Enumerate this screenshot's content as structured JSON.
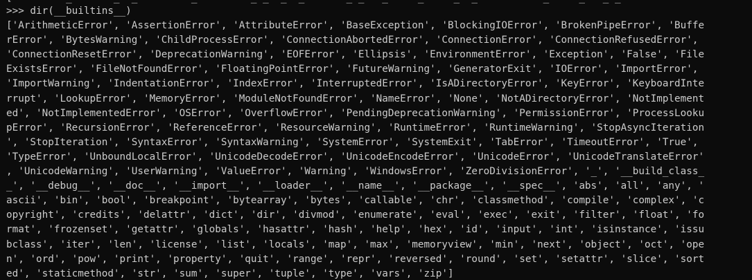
{
  "console": {
    "residue_line": "[         _       _  _         _         _ _  _  _       _ _   _     _     _  _           _     _   _ _",
    "prompt_line": ">>> dir(__builtins__)",
    "output_lines": [
      "['ArithmeticError', 'AssertionError', 'AttributeError', 'BaseException', 'BlockingIOError', 'BrokenPipeError', 'Buffe",
      "rError', 'BytesWarning', 'ChildProcessError', 'ConnectionAbortedError', 'ConnectionError', 'ConnectionRefusedError',",
      "'ConnectionResetError', 'DeprecationWarning', 'EOFError', 'Ellipsis', 'EnvironmentError', 'Exception', 'False', 'File",
      "ExistsError', 'FileNotFoundError', 'FloatingPointError', 'FutureWarning', 'GeneratorExit', 'IOError', 'ImportError',",
      "'ImportWarning', 'IndentationError', 'IndexError', 'InterruptedError', 'IsADirectoryError', 'KeyError', 'KeyboardInte",
      "rrupt', 'LookupError', 'MemoryError', 'ModuleNotFoundError', 'NameError', 'None', 'NotADirectoryError', 'NotImplement",
      "ed', 'NotImplementedError', 'OSError', 'OverflowError', 'PendingDeprecationWarning', 'PermissionError', 'ProcessLooku",
      "pError', 'RecursionError', 'ReferenceError', 'ResourceWarning', 'RuntimeError', 'RuntimeWarning', 'StopAsyncIteration",
      "', 'StopIteration', 'SyntaxError', 'SyntaxWarning', 'SystemError', 'SystemExit', 'TabError', 'TimeoutError', 'True',",
      "'TypeError', 'UnboundLocalError', 'UnicodeDecodeError', 'UnicodeEncodeError', 'UnicodeError', 'UnicodeTranslateError'",
      ", 'UnicodeWarning', 'UserWarning', 'ValueError', 'Warning', 'WindowsError', 'ZeroDivisionError', '_', '__build_class_",
      "_', '__debug__', '__doc__', '__import__', '__loader__', '__name__', '__package__', '__spec__', 'abs', 'all', 'any', '",
      "ascii', 'bin', 'bool', 'breakpoint', 'bytearray', 'bytes', 'callable', 'chr', 'classmethod', 'compile', 'complex', 'c",
      "opyright', 'credits', 'delattr', 'dict', 'dir', 'divmod', 'enumerate', 'eval', 'exec', 'exit', 'filter', 'float', 'fo",
      "rmat', 'frozenset', 'getattr', 'globals', 'hasattr', 'hash', 'help', 'hex', 'id', 'input', 'int', 'isinstance', 'issu",
      "bclass', 'iter', 'len', 'license', 'list', 'locals', 'map', 'max', 'memoryview', 'min', 'next', 'object', 'oct', 'ope",
      "n', 'ord', 'pow', 'print', 'property', 'quit', 'range', 'repr', 'reversed', 'round', 'set', 'setattr', 'slice', 'sort",
      "ed', 'staticmethod', 'str', 'sum', 'super', 'tuple', 'type', 'vars', 'zip']"
    ],
    "colors": {
      "background": "#0c0c0c",
      "text": "#cccccc"
    }
  }
}
